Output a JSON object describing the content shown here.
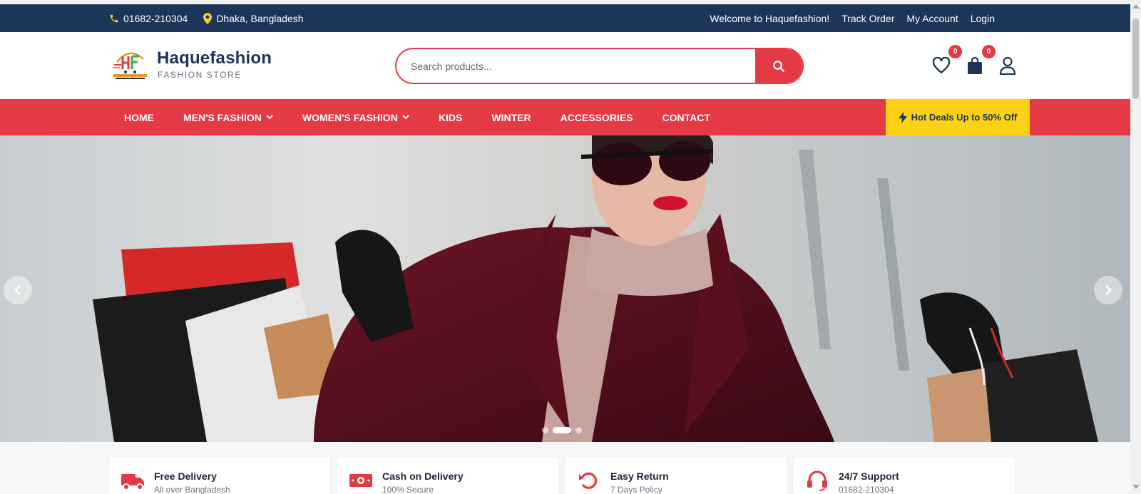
{
  "topbar": {
    "phone": "01682-210304",
    "location": "Dhaka, Bangladesh",
    "welcome": "Welcome to Haquefashion!",
    "links": [
      "Track Order",
      "My Account",
      "Login"
    ]
  },
  "header": {
    "brand_name": "Haquefashion",
    "brand_tagline": "FASHION STORE",
    "search_placeholder": "Search products...",
    "wishlist_count": "0",
    "cart_count": "0"
  },
  "nav": {
    "items": [
      {
        "label": "HOME",
        "dropdown": false
      },
      {
        "label": "MEN'S FASHION",
        "dropdown": true
      },
      {
        "label": "WOMEN'S FASHION",
        "dropdown": true
      },
      {
        "label": "KIDS",
        "dropdown": false
      },
      {
        "label": "WINTER",
        "dropdown": false
      },
      {
        "label": "ACCESSORIES",
        "dropdown": false
      },
      {
        "label": "CONTACT",
        "dropdown": false
      }
    ],
    "hot_deals": "Hot Deals Up to 50% Off"
  },
  "hero": {
    "slide_count": 3,
    "active_slide": 2
  },
  "features": [
    {
      "icon": "truck-icon",
      "title": "Free Delivery",
      "subtitle": "All over Bangladesh"
    },
    {
      "icon": "money-icon",
      "title": "Cash on Delivery",
      "subtitle": "100% Secure"
    },
    {
      "icon": "undo-icon",
      "title": "Easy Return",
      "subtitle": "7 Days Policy"
    },
    {
      "icon": "headset-icon",
      "title": "24/7 Support",
      "subtitle": "01682-210304"
    }
  ],
  "colors": {
    "navy": "#1c3558",
    "accent_red": "#e63946",
    "deal_yellow": "#fcd116",
    "icon_yellow": "#fcd116"
  }
}
